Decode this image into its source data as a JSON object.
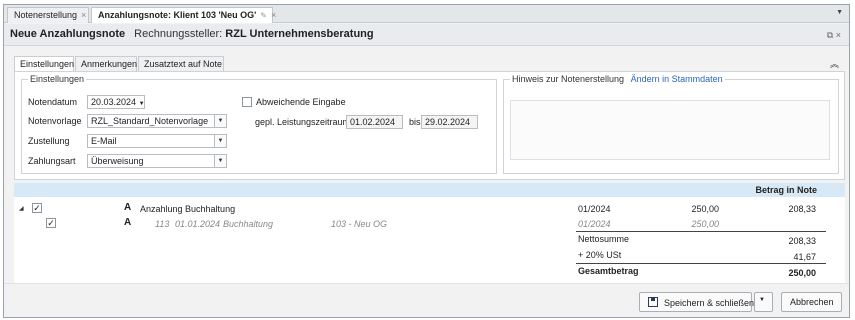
{
  "tabs": [
    {
      "label": "Notenerstellung",
      "close": "×"
    },
    {
      "label": "Anzahlungsnote: Klient 103 'Neu OG'",
      "edit": "✎",
      "close": "×"
    }
  ],
  "title": {
    "main": "Neue Anzahlungsnote",
    "issuer_label": "Rechnungssteller:",
    "issuer": "RZL Unternehmensberatung"
  },
  "subtabs": [
    "Einstellungen",
    "Anmerkungen",
    "Zusatztext auf Note"
  ],
  "settings": {
    "legend": "Einstellungen",
    "notendatum_label": "Notendatum",
    "notendatum": "20.03.2024",
    "notenvorlage_label": "Notenvorlage",
    "notenvorlage": "RZL_Standard_Notenvorlage",
    "zustellung_label": "Zustellung",
    "zustellung": "E-Mail",
    "zahlungsart_label": "Zahlungsart",
    "zahlungsart": "Überweisung",
    "abweichende_label": "Abweichende Eingabe",
    "abweichende_checked": false,
    "leistungszeitraum_label": "gepl. Leistungszeitraum",
    "leistung_von": "01.02.2024",
    "bis_label": "bis",
    "leistung_bis": "29.02.2024"
  },
  "hint": {
    "label": "Hinweis zur Notenerstellung",
    "link": "Ändern in Stammdaten"
  },
  "table": {
    "header": "Betrag in Note",
    "rows": [
      {
        "checked": true,
        "badge": "A",
        "text": "Anzahlung Buchhaltung",
        "period": "01/2024",
        "amount": "250,00",
        "note_amount": "208,33"
      },
      {
        "checked": true,
        "badge": "A",
        "nr": "113",
        "date": "01.01.2024",
        "desc": "Buchhaltung",
        "client": "103 - Neu OG",
        "period": "01/2024",
        "amount": "250,00"
      }
    ],
    "netto_label": "Nettosumme",
    "netto": "208,33",
    "ust_label": "+ 20% USt",
    "ust": "41,67",
    "gesamt_label": "Gesamtbetrag",
    "gesamt": "250,00"
  },
  "footer": {
    "save_label": "Speichern & schließen",
    "cancel_label": "Abbrechen"
  },
  "icons": {
    "save": "save-icon",
    "dropdown": "chevron-down-icon",
    "collapse": "chevrons-up-icon"
  }
}
